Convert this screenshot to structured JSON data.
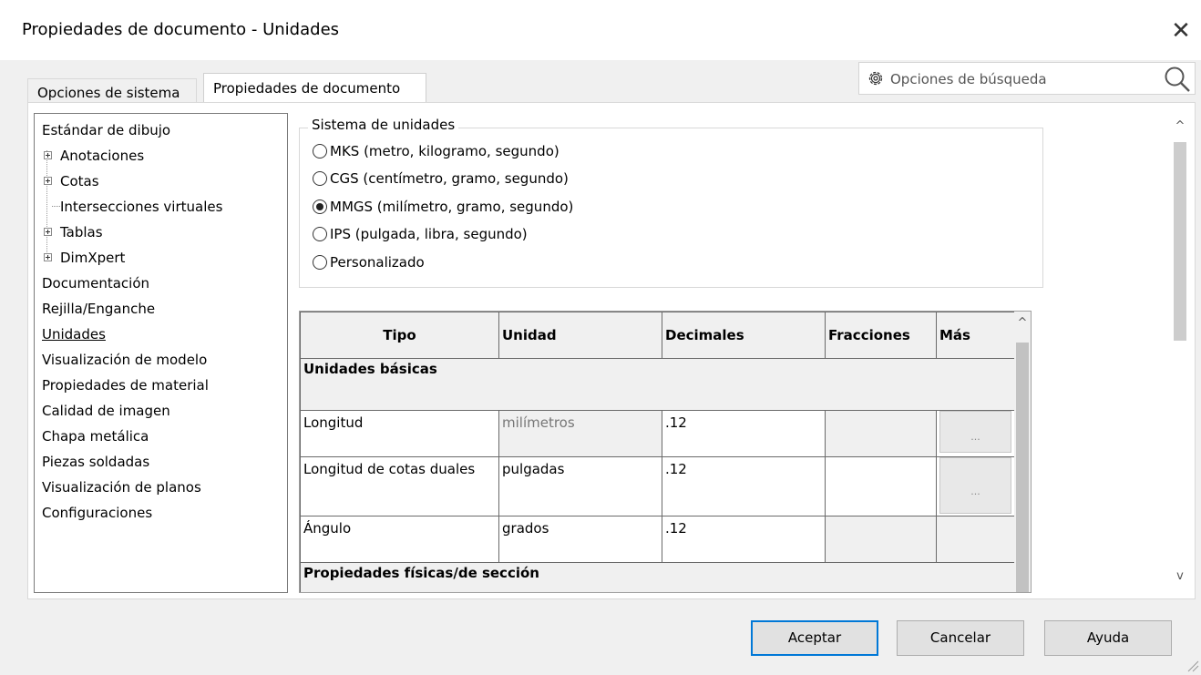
{
  "window": {
    "title": "Propiedades de documento - Unidades",
    "close_glyph": "✕"
  },
  "tabs": [
    {
      "label": "Opciones de sistema",
      "active": false
    },
    {
      "label": "Propiedades de documento",
      "active": true
    }
  ],
  "search": {
    "placeholder": "Opciones de búsqueda",
    "icon": "gear-icon",
    "button_icon": "magnifier-icon"
  },
  "tree": {
    "items": [
      {
        "label": "Estándar de dibujo",
        "level": 0
      },
      {
        "label": "Anotaciones",
        "level": 1,
        "expandable": true
      },
      {
        "label": "Cotas",
        "level": 1,
        "expandable": true
      },
      {
        "label": "Intersecciones virtuales",
        "level": 1,
        "expandable": false
      },
      {
        "label": "Tablas",
        "level": 1,
        "expandable": true
      },
      {
        "label": "DimXpert",
        "level": 1,
        "expandable": true
      },
      {
        "label": "Documentación",
        "level": 0
      },
      {
        "label": "Rejilla/Enganche",
        "level": 0
      },
      {
        "label": "Unidades",
        "level": 0,
        "selected": true
      },
      {
        "label": "Visualización de modelo",
        "level": 0
      },
      {
        "label": "Propiedades de material",
        "level": 0
      },
      {
        "label": "Calidad de imagen",
        "level": 0
      },
      {
        "label": "Chapa metálica",
        "level": 0
      },
      {
        "label": "Piezas soldadas",
        "level": 0
      },
      {
        "label": "Visualización de planos",
        "level": 0
      },
      {
        "label": "Configuraciones",
        "level": 0
      }
    ]
  },
  "unit_system": {
    "title": "Sistema de unidades",
    "options": [
      {
        "label": "MKS (metro, kilogramo, segundo)",
        "selected": false
      },
      {
        "label": "CGS (centímetro, gramo, segundo)",
        "selected": false
      },
      {
        "label": "MMGS (milímetro, gramo, segundo)",
        "selected": true
      },
      {
        "label": "IPS (pulgada, libra, segundo)",
        "selected": false
      },
      {
        "label": "Personalizado",
        "selected": false
      }
    ]
  },
  "units_table": {
    "headers": [
      "Tipo",
      "Unidad",
      "Decimales",
      "Fracciones",
      "Más"
    ],
    "section_basic": "Unidades básicas",
    "rows": [
      {
        "tipo": "Longitud",
        "unidad": "milímetros",
        "decimales": ".12",
        "fracciones": "",
        "mas": "..."
      },
      {
        "tipo": "Longitud de cotas duales",
        "unidad": "pulgadas",
        "decimales": ".12",
        "fracciones": "",
        "mas": "..."
      },
      {
        "tipo": "Ángulo",
        "unidad": "grados",
        "decimales": ".12",
        "fracciones": "",
        "mas": ""
      }
    ],
    "section_physical": "Propiedades físicas/de sección"
  },
  "scroll": {
    "up_glyph": "^",
    "down_glyph": "v"
  },
  "buttons": {
    "ok": "Aceptar",
    "cancel": "Cancelar",
    "help": "Ayuda"
  }
}
